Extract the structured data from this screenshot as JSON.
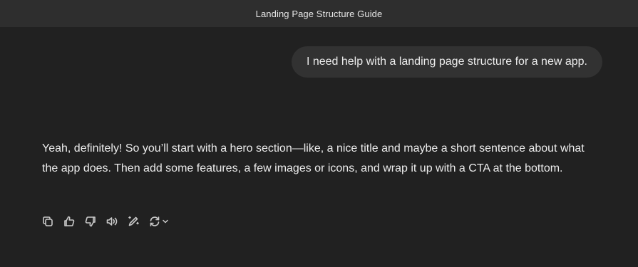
{
  "window": {
    "title": "Landing Page Structure Guide"
  },
  "conversation": {
    "user_message": "I need help with a landing page structure for a new app.",
    "assistant_message": "Yeah, definitely! So you’ll start with a hero section—like, a nice title and maybe a short sentence about what the app does. Then add some features, a few images or icons, and wrap it up with a CTA at the bottom."
  },
  "actions": {
    "icons": [
      "copy-icon",
      "thumbs-up-icon",
      "thumbs-down-icon",
      "read-aloud-icon",
      "edit-icon",
      "regenerate-icon",
      "chevron-down-icon"
    ]
  },
  "colors": {
    "background": "#212121",
    "titlebar": "#2e2e2e",
    "user_bubble": "#323232",
    "text": "#ececec",
    "icon": "#c9c9c9"
  }
}
